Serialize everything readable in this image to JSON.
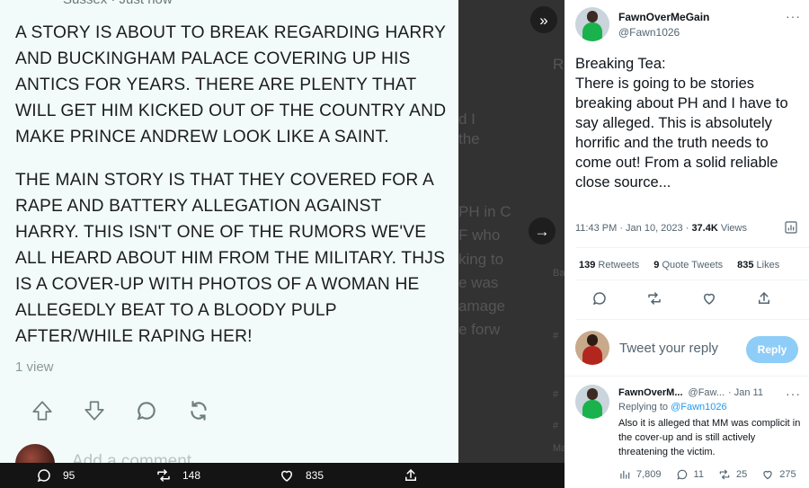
{
  "post": {
    "top_cut_text": "Sussex · Just now",
    "paragraph_1": "A STORY IS ABOUT TO BREAK REGARDING HARRY AND BUCKINGHAM PALACE COVERING UP HIS ANTICS FOR YEARS. THERE ARE PLENTY THAT WILL GET HIM KICKED OUT OF THE COUNTRY AND MAKE PRINCE ANDREW LOOK LIKE A SAINT.",
    "paragraph_2": "THE MAIN STORY IS THAT THEY COVERED FOR A RAPE AND BATTERY ALLEGATION AGAINST HARRY. THIS ISN'T ONE OF THE RUMORS WE'VE ALL HEARD ABOUT HIM FROM THE MILITARY. THJS IS A COVER-UP WITH PHOTOS OF A WOMAN HE ALLEGEDLY BEAT TO A BLOODY PULP AFTER/WHILE RAPING HER!",
    "views": "1 view",
    "actions": [
      "upvote-icon",
      "downvote-icon",
      "comment-icon",
      "share-icon"
    ],
    "comment_placeholder": "Add a comment"
  },
  "bottom_bar": {
    "replies": "95",
    "retweets": "148",
    "likes": "835"
  },
  "background_fragments": [
    "R",
    "d I",
    "the",
    "PH in C",
    "F who",
    "king to",
    "e was",
    "amage",
    "e forw",
    "#",
    "Ba",
    "#",
    "#",
    "Ma"
  ],
  "tweet": {
    "author_name": "FawnOverMeGain",
    "author_handle": "@Fawn1026",
    "more": "···",
    "text": "Breaking Tea:\nThere is going to be stories breaking about PH and I have to say alleged. This is absolutely horrific and the truth needs to come out! From a solid reliable close source...",
    "time": "11:43 PM · Jan 10, 2023 · ",
    "views_count": "37.4K",
    "views_label": " Views",
    "retweets_count": "139",
    "retweets_label": " Retweets",
    "quotes_count": "9",
    "quotes_label": " Quote Tweets",
    "likes_count": "835",
    "likes_label": " Likes",
    "reply_placeholder": "Tweet your reply",
    "reply_button": "Reply"
  },
  "reply": {
    "name": "FawnOverM...",
    "handle": "@Faw...",
    "date": "· Jan 11",
    "replying_to_label": "Replying to ",
    "replying_to_handle": "@Fawn1026",
    "text": "Also it is alleged that MM was complicit in the cover-up and is still actively threatening the victim.",
    "views": "7,809",
    "replies": "11",
    "retweets": "25",
    "likes": "275"
  },
  "colors": {
    "left_bg": "#f2fbfa",
    "dark_bg": "#323232",
    "accent_blue": "#1d9bf0",
    "reply_button": "#8ecdf8"
  }
}
